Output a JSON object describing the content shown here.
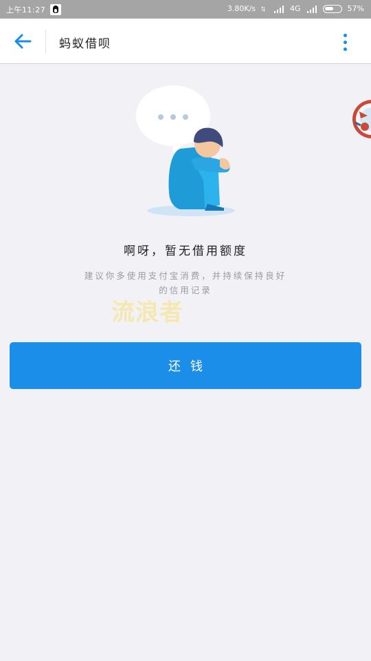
{
  "status_bar": {
    "time": "上午11:27",
    "speed": "3.80K/s",
    "network": "4G",
    "battery_percent": "57%",
    "battery_level": 0.57,
    "text_color": "#ffffff",
    "background": "#a5a5a5"
  },
  "app_bar": {
    "title": "蚂蚁借呗",
    "back_icon": "arrow-left-icon",
    "more_icon": "more-vertical-icon",
    "accent": "#1a8be8"
  },
  "empty_state": {
    "title": "啊呀，暂无借用额度",
    "description": "建议你多使用支付宝消费，并持续保持良好的信用记录",
    "illustration": "sad-person-with-speech-bubble"
  },
  "watermark": "流浪者",
  "repay_button": {
    "label": "还钱",
    "color": "#1a8ee9"
  }
}
